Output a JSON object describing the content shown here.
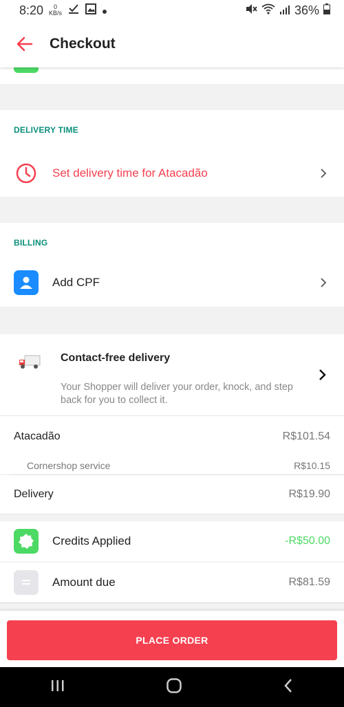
{
  "status": {
    "time": "8:20",
    "kb_value": "0",
    "kb_unit": "KB/s",
    "battery": "36%"
  },
  "header": {
    "title": "Checkout"
  },
  "delivery_time": {
    "section_label": "DELIVERY TIME",
    "label": "Set delivery time for Atacadão"
  },
  "billing": {
    "section_label": "BILLING",
    "label": "Add CPF"
  },
  "contact_free": {
    "title": "Contact-free delivery",
    "description": "Your Shopper will deliver your order, knock, and step back for you to collect it."
  },
  "summary": {
    "store_label": "Atacadão",
    "store_value": "R$101.54",
    "service_label": "Cornershop service",
    "service_value": "R$10.15",
    "delivery_label": "Delivery",
    "delivery_value": "R$19.90",
    "credits_label": "Credits Applied",
    "credits_value": "-R$50.00",
    "due_label": "Amount due",
    "due_value": "R$81.59"
  },
  "footer": {
    "button_label": "PLACE ORDER"
  },
  "colors": {
    "accent": "#f5404f",
    "section": "#0a8f7a",
    "credit": "#4cd964",
    "billing": "#1a8cff"
  }
}
